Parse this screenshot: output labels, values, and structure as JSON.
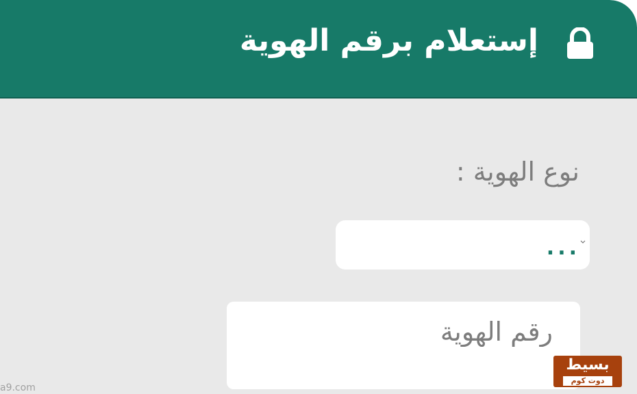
{
  "header": {
    "title": "إستعلام برقم الهوية",
    "icon": "lock-icon",
    "background_color": "#177a68"
  },
  "form": {
    "id_type_label": "نوع الهوية :",
    "id_type_select": {
      "value": "...",
      "icon": "chevron-down-icon"
    },
    "id_number_input": {
      "value": "",
      "placeholder": "رقم الهوية"
    }
  },
  "watermark": {
    "logo_main": "بسيط",
    "logo_sub": "دوت كوم",
    "url_fragment": "a9.com",
    "color": "#a7410d"
  }
}
